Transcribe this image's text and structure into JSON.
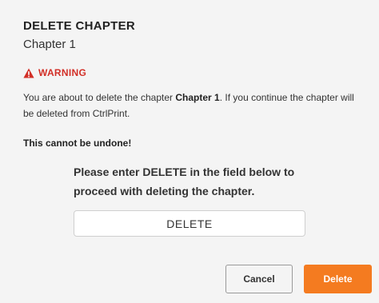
{
  "dialog": {
    "title": "DELETE CHAPTER",
    "subtitle": "Chapter 1",
    "warning_label": "WARNING",
    "message": {
      "prefix": "You are about to delete the chapter ",
      "chapter_name": "Chapter 1",
      "suffix": ". If you continue the chapter will be deleted from CtrlPrint."
    },
    "undone_text": "This cannot be undone!",
    "instruction": "Please enter DELETE in the field below to proceed with deleting the chapter.",
    "confirm_input": {
      "value": "DELETE",
      "placeholder": ""
    },
    "cancel_label": "Cancel",
    "delete_label": "Delete"
  },
  "colors": {
    "warning": "#d22f27",
    "accent": "#f47b20",
    "background": "#f4f4f4"
  },
  "icons": {
    "warning": "warning-triangle-icon"
  }
}
